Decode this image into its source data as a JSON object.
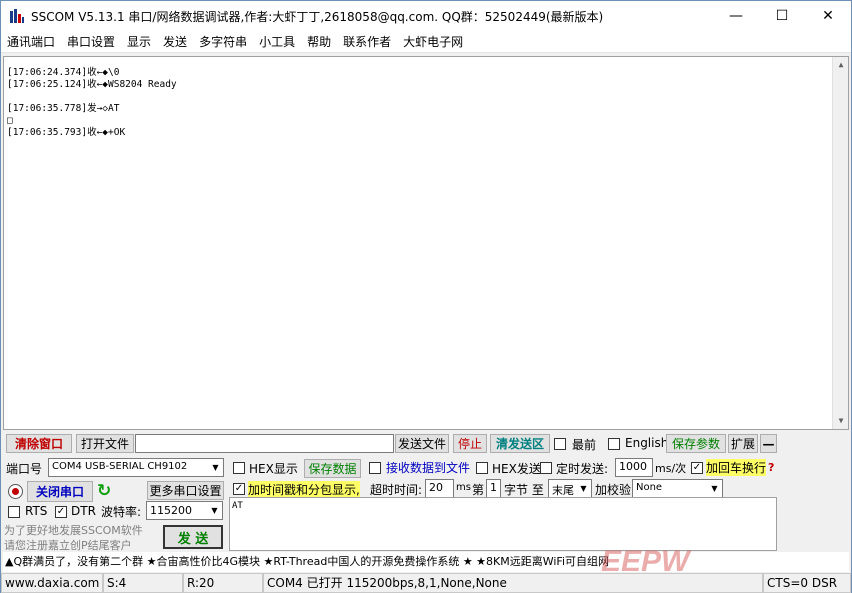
{
  "window": {
    "title": "SSCOM V5.13.1 串口/网络数据调试器,作者:大虾丁丁,2618058@qq.com. QQ群：52502449(最新版本)",
    "icon": "sscom-app-icon"
  },
  "menu": [
    "通讯端口",
    "串口设置",
    "显示",
    "发送",
    "多字符串",
    "小工具",
    "帮助",
    "联系作者",
    "大虾电子网"
  ],
  "receive": {
    "lines": [
      "[17:06:24.374]收←◆\\0",
      "[17:06:25.124]收←◆WS8204 Ready",
      "",
      "[17:06:35.778]发→◇AT",
      "□",
      "[17:06:35.793]收←◆+OK"
    ]
  },
  "toolbar": {
    "clear_window": "清除窗口",
    "open_file": "打开文件",
    "file_path": "",
    "send_file": "发送文件",
    "stop": "停止",
    "clear_send": "清发送区",
    "topmost": "最前",
    "english": "English",
    "save_params": "保存参数",
    "expand": "扩展",
    "collapse": "—"
  },
  "port": {
    "port_label": "端口号",
    "port_value": "COM4 USB-SERIAL CH9102",
    "close_port": "关闭串口",
    "more_settings": "更多串口设置",
    "rts": "RTS",
    "dtr": "DTR",
    "baud_label": "波特率:",
    "baud_value": "115200",
    "promo1": "为了更好地发展SSCOM软件",
    "promo2": "请您注册嘉立创P结尾客户",
    "send": "发 送"
  },
  "options": {
    "hex_display": "HEX显示",
    "save_data": "保存数据",
    "recv_to_file": "接收数据到文件",
    "hex_send": "HEX发送",
    "timed_send": "定时发送:",
    "interval": "1000",
    "interval_unit": "ms/次",
    "add_crlf": "加回车换行",
    "add_timestamp": "加时间戳和分包显示,",
    "timeout_label": "超时时间:",
    "timeout_value": "20",
    "timeout_unit": "ms",
    "byte_prefix": "第",
    "byte_value": "1",
    "byte_unit": "字节 至",
    "end_value": "末尾",
    "checksum_label": "加校验",
    "checksum_value": "None"
  },
  "send_text": "AT",
  "ad": "▲Q群满员了，没有第二个群  ★合宙高性价比4G模块  ★RT-Thread中国人的开源免费操作系统  ★  ★8KM远距离WiFi可自组网",
  "watermark": "EEPW",
  "status": {
    "site": "www.daxia.com",
    "sent": "S:4",
    "received": "R:20",
    "port_state": "COM4 已打开  115200bps,8,1,None,None",
    "lines": "CTS=0 DSR"
  }
}
